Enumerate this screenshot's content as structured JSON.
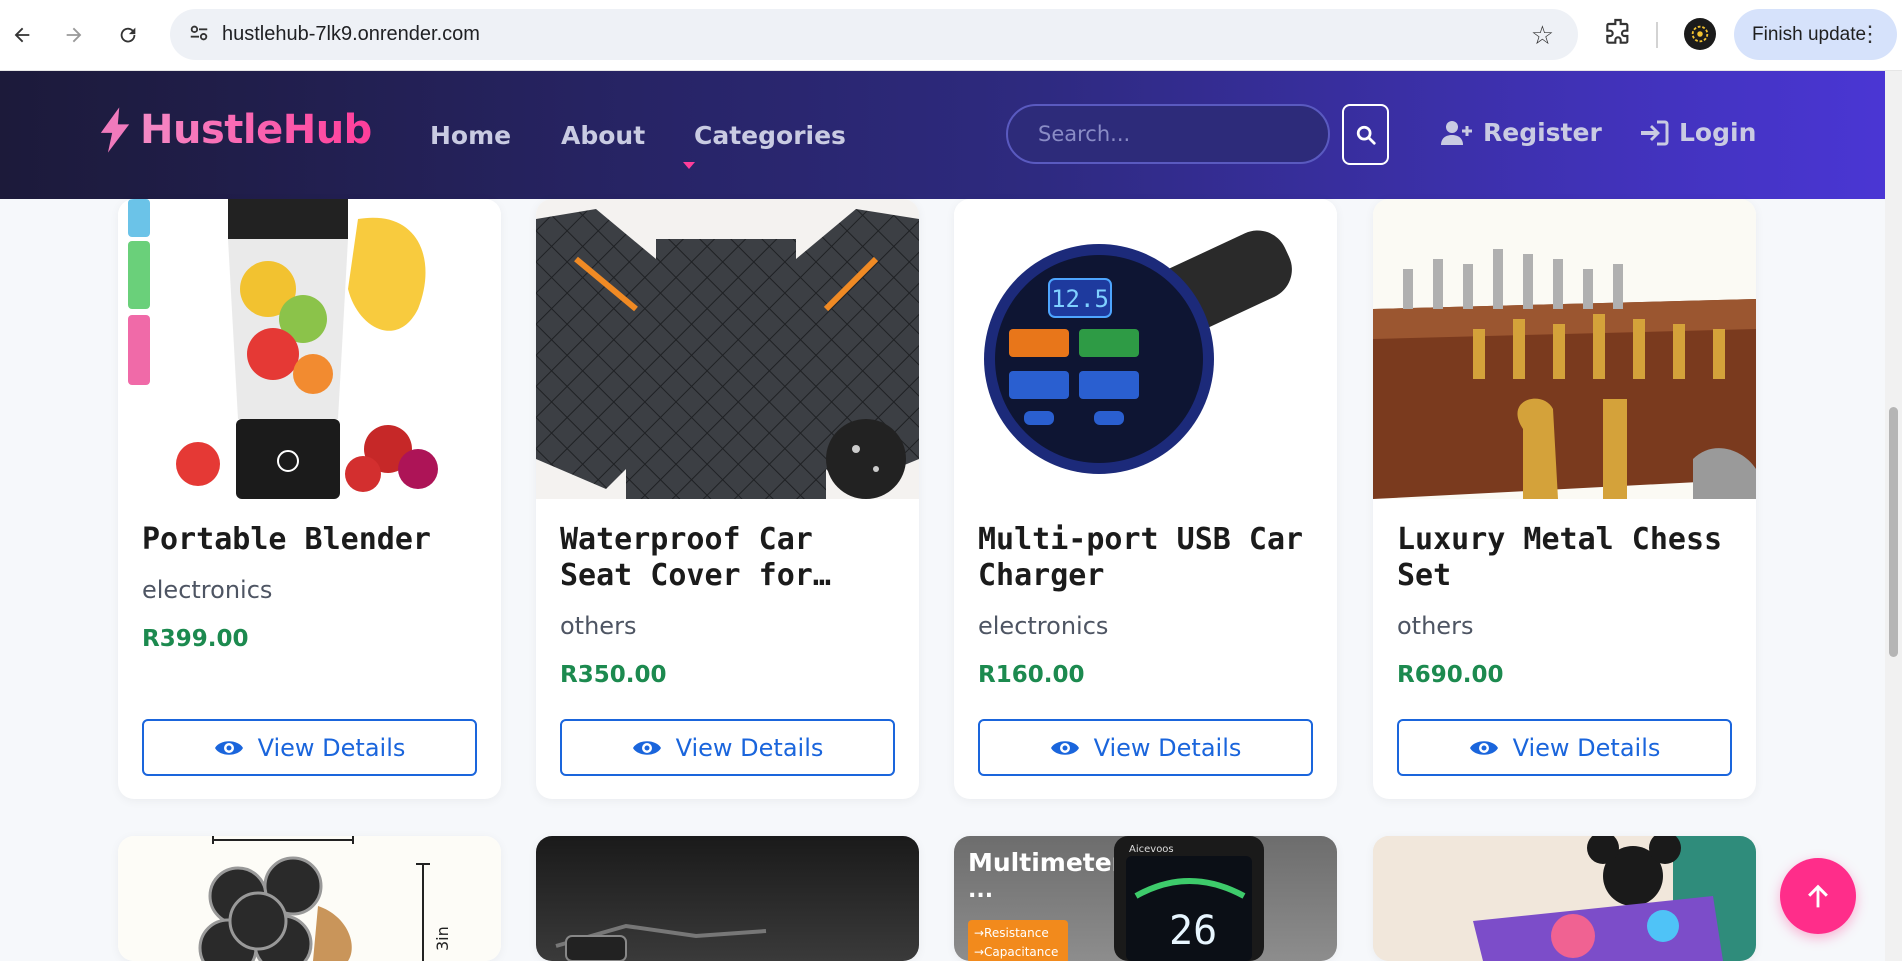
{
  "browser": {
    "url": "hustlehub-7lk9.onrender.com",
    "update_label": "Finish update"
  },
  "header": {
    "logo_text": "HustleHub",
    "nav": [
      "Home",
      "About",
      "Categories"
    ],
    "search_placeholder": "Search...",
    "register_label": "Register",
    "login_label": "Login",
    "colors": {
      "brand_pink": "#ff3d9a",
      "header_dark": "#1c1a3a",
      "header_light": "#4a36d4"
    }
  },
  "products": [
    {
      "title": "Portable Blender",
      "category": "electronics",
      "price": "R399.00",
      "button": "View Details",
      "image_icon": "blender-image"
    },
    {
      "title": "Waterproof Car Seat Cover for…",
      "category": "others",
      "price": "R350.00",
      "button": "View Details",
      "image_icon": "car-seat-cover-image"
    },
    {
      "title": "Multi-port USB Car Charger",
      "category": "electronics",
      "price": "R160.00",
      "button": "View Details",
      "image_icon": "usb-charger-image"
    },
    {
      "title": "Luxury Metal Chess Set",
      "category": "others",
      "price": "R690.00",
      "button": "View Details",
      "image_icon": "chess-set-image"
    }
  ],
  "next_row": {
    "multimeter_title": "Multimeter",
    "multimeter_ellipsis": "...",
    "multimeter_tags": [
      "→Resistance",
      "→Capacitance"
    ],
    "multimeter_reading": "26",
    "multimeter_brand": "Aicevoos",
    "size_label": "3in"
  },
  "price_color": "#1c8a4f",
  "button_color": "#1a65dc"
}
